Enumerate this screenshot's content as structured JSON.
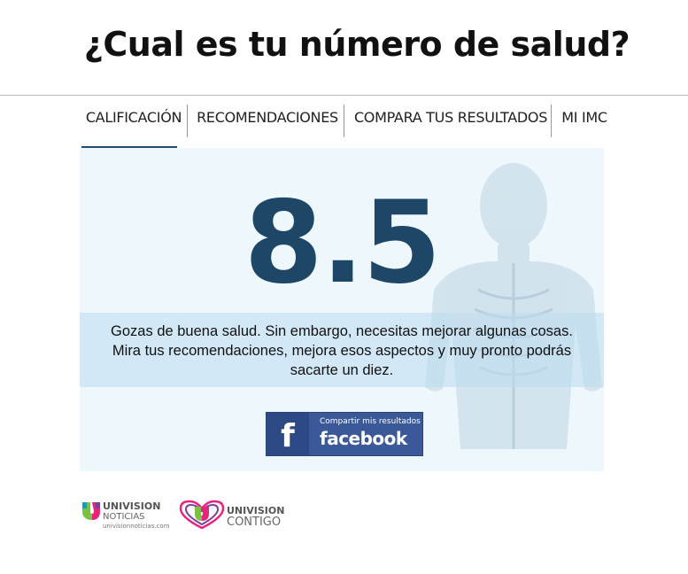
{
  "page": {
    "title": "¿Cual es tu número de salud?"
  },
  "tabs": [
    {
      "label": "CALIFICACIÓN",
      "active": true
    },
    {
      "label": "RECOMENDACIONES",
      "active": false
    },
    {
      "label": "COMPARA TUS RESULTADOS",
      "active": false
    },
    {
      "label": "MI IMC",
      "active": false
    }
  ],
  "result": {
    "score": "8.5",
    "message": "Gozas de buena salud. Sin embargo, necesitas mejorar algunas cosas. Mira tus recomendaciones, mejora esos aspectos y muy pronto podrás sacarte un diez."
  },
  "share": {
    "caption": "Compartir mis resultados",
    "network": "facebook",
    "logo_letter": "f"
  },
  "footer": {
    "logo1": {
      "brand": "UNIVISION",
      "sub": "NOTICIAS",
      "url": "univisionnoticias.com"
    },
    "logo2": {
      "brand": "UNIVISION",
      "sub": "CONTIGO"
    }
  },
  "colors": {
    "accent": "#1e4666",
    "panel_bg": "#eef7fc",
    "facebook": "#3b5998"
  }
}
